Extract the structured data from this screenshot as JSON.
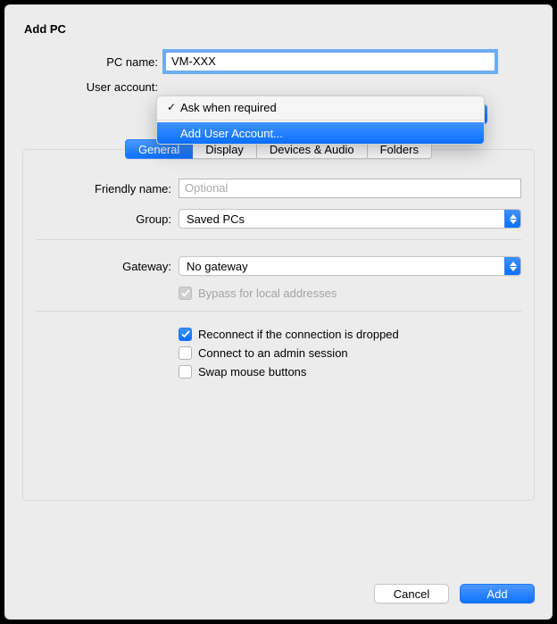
{
  "title": "Add PC",
  "labels": {
    "pc_name": "PC name:",
    "user_account": "User account:",
    "friendly_name": "Friendly name:",
    "group": "Group:",
    "gateway": "Gateway:"
  },
  "pc_name_value": "VM-XXX",
  "user_account": {
    "options": [
      {
        "label": "Ask when required",
        "checked": true
      },
      {
        "label": "Add User Account...",
        "selected": true
      }
    ]
  },
  "tabs": [
    "General",
    "Display",
    "Devices & Audio",
    "Folders"
  ],
  "active_tab": 0,
  "friendly_name_placeholder": "Optional",
  "group_value": "Saved PCs",
  "gateway_value": "No gateway",
  "bypass_label": "Bypass for local addresses",
  "bypass_checked": true,
  "bypass_disabled": true,
  "reconnect_label": "Reconnect if the connection is dropped",
  "reconnect_checked": true,
  "admin_label": "Connect to an admin session",
  "admin_checked": false,
  "swap_label": "Swap mouse buttons",
  "swap_checked": false,
  "buttons": {
    "cancel": "Cancel",
    "add": "Add"
  }
}
